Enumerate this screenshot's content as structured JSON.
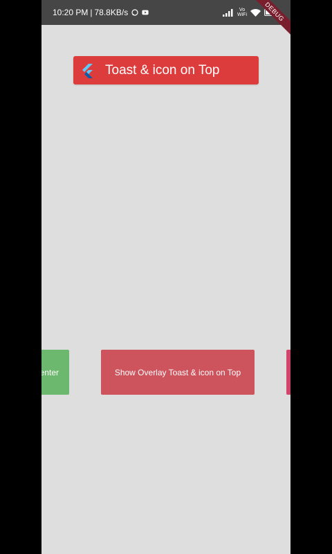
{
  "status_bar": {
    "time": "10:20 PM",
    "separator": "|",
    "speed": "78.8KB/s",
    "network_label": "Vo\nWiFi",
    "icons": [
      "whatsapp-icon",
      "youtube-icon",
      "signal-icon",
      "wifi-icon",
      "battery-icon"
    ]
  },
  "debug_banner": {
    "label": "DEBUG"
  },
  "toast": {
    "text": "Toast & icon on Top",
    "icon": "flutter-logo-icon"
  },
  "buttons": {
    "left_label": "Center",
    "center_label": "Show Overlay Toast & icon on Top",
    "right_label": ""
  },
  "colors": {
    "background": "#dedede",
    "toast": "#dd3c3c",
    "left_button": "#6db86f",
    "center_button": "#cd535c",
    "right_button": "#d1456b"
  }
}
